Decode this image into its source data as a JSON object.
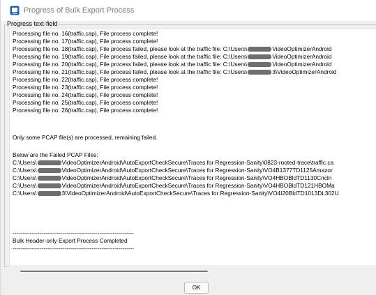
{
  "window": {
    "title": "Progress of Bulk Export Process"
  },
  "panel": {
    "legend": "Progress text-field"
  },
  "log": {
    "lines": [
      "Processing file no. 16(traffic.cap), File process complete!",
      "Processing file no. 17(traffic.cap), File process complete!",
      "Processing file no. 18(traffic.cap), File process failed, please look at the traffic file: C:\\Users\\",
      "VideoOptimizerAndroid",
      "Processing file no. 19(traffic.cap), File process failed, please look at the traffic file: C:\\Users\\",
      "VideoOptimizerAndroid",
      "Processing file no. 20(traffic.cap), File process failed, please look at the traffic file: C:\\Users\\",
      "VideoOptimizerAndroid",
      "Processing file no. 21(traffic.cap), File process failed, please look at the traffic file: C:\\Users\\",
      "3\\VideoOptimizerAndroid",
      "Processing file no. 22(traffic.cap), File process complete!",
      "Processing file no. 23(traffic.cap), File process complete!",
      "Processing file no. 24(traffic.cap), File process complete!",
      "Processing file no. 25(traffic.cap), File process complete!",
      "Processing file no. 26(traffic.cap), File process complete!",
      "Only some PCAP file(s) are processed, remaining failed.",
      "Below are the Failed PCAP Files:",
      "C:\\Users\\",
      "VideoOptimizerAndroid\\AutoExportCheckSecure\\Traces for Regression-Sanity\\0823-rooted-trace\\traffic.ca",
      "C:\\Users\\",
      "VideoOptimizerAndroid\\AutoExportCheckSecure\\Traces for Regression-Sanity\\VO4B1377TD1125Amazor",
      "C:\\Users\\",
      "VideoOptimizerAndroid\\AutoExportCheckSecure\\Traces for Regression-Sanity\\VO4HBOBldTD1130Cricln",
      "C:\\Users\\",
      "VideoOptimizerAndroid\\AutoExportCheckSecure\\Traces for Regression-Sanity\\VO4HBOBldTD121HBOMa",
      "C:\\Users\\",
      "3\\VideoOptimizerAndroid\\AutoExportCheckSecure\\Traces for Regression-Sanity\\VO4I20BldTD1013DL302U",
      "---------------------------------------------------------------",
      "Bulk Header-only Export Process Completed",
      "---------------------------------------------------------------"
    ]
  },
  "footer": {
    "ok_label": "OK"
  },
  "icons": {
    "app": "app-window-icon"
  },
  "colors": {
    "title_text": "#7d7d7d",
    "redaction": "#6f6f6f",
    "icon_blue": "#2b5fb0"
  }
}
